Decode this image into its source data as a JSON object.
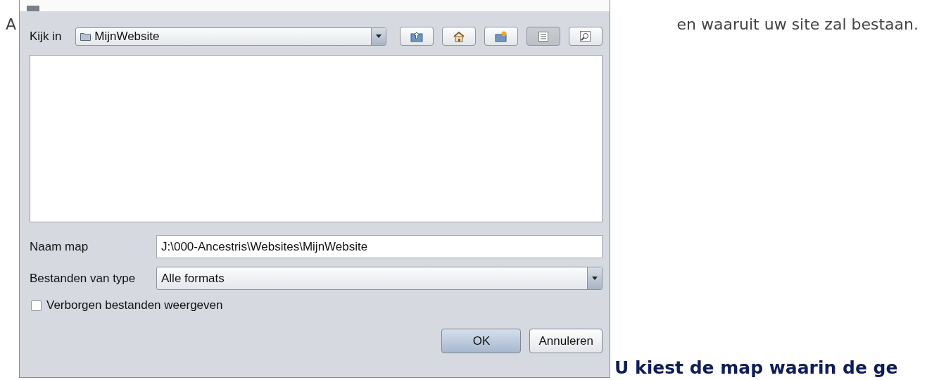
{
  "page": {
    "text_before": "A",
    "text_after": "en waaruit uw site zal bestaan.",
    "heading": "U kiest de map waarin de ge"
  },
  "dialog": {
    "look_in": {
      "label": "Kijk in",
      "value": "MijnWebsite"
    },
    "toolbar": [
      {
        "kind": "up",
        "selected": false
      },
      {
        "kind": "home",
        "selected": false
      },
      {
        "kind": "newfolder",
        "selected": false
      },
      {
        "kind": "list",
        "selected": true
      },
      {
        "kind": "details",
        "selected": false
      }
    ],
    "folder_name": {
      "label": "Naam map",
      "value": "J:\\000-Ancestris\\Websites\\MijnWebsite"
    },
    "file_type": {
      "label": "Bestanden van type",
      "value": "Alle formats"
    },
    "show_hidden": {
      "label": "Verborgen bestanden weergeven",
      "checked": false
    },
    "buttons": [
      {
        "label": "OK",
        "kind": "primary"
      },
      {
        "label": "Annuleren",
        "kind": "normal"
      }
    ]
  }
}
